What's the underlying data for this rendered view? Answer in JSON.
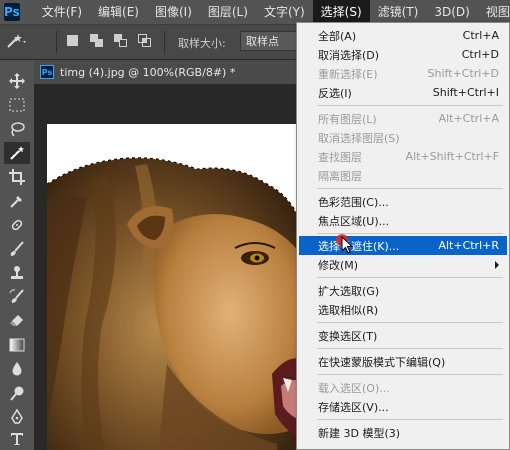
{
  "app": {
    "logo": "Ps"
  },
  "menubar": {
    "items": [
      "文件(F)",
      "编辑(E)",
      "图像(I)",
      "图层(L)",
      "文字(Y)",
      "选择(S)",
      "滤镜(T)",
      "3D(D)",
      "视图("
    ]
  },
  "options": {
    "sample_size_label": "取样大小:",
    "sample_size_value": "取样点"
  },
  "document": {
    "tab_title": "timg (4).jpg @ 100%(RGB/8#) *",
    "ps_icon": "Ps"
  },
  "select_menu": {
    "items": [
      {
        "label": "全部(A)",
        "shortcut": "Ctrl+A",
        "disabled": false
      },
      {
        "label": "取消选择(D)",
        "shortcut": "Ctrl+D",
        "disabled": false
      },
      {
        "label": "重新选择(E)",
        "shortcut": "Shift+Ctrl+D",
        "disabled": true
      },
      {
        "label": "反选(I)",
        "shortcut": "Shift+Ctrl+I",
        "disabled": false
      },
      {
        "label": "所有图层(L)",
        "shortcut": "Alt+Ctrl+A",
        "disabled": true
      },
      {
        "label": "取消选择图层(S)",
        "shortcut": "",
        "disabled": true
      },
      {
        "label": "查找图层",
        "shortcut": "Alt+Shift+Ctrl+F",
        "disabled": true
      },
      {
        "label": "隔离图层",
        "shortcut": "",
        "disabled": true
      },
      {
        "label": "色彩范围(C)...",
        "shortcut": "",
        "disabled": false
      },
      {
        "label": "焦点区域(U)...",
        "shortcut": "",
        "disabled": false
      },
      {
        "label": "选择并遮住(K)...",
        "shortcut": "Alt+Ctrl+R",
        "disabled": false,
        "highlighted": true
      },
      {
        "label": "修改(M)",
        "shortcut": "",
        "disabled": false,
        "submenu": true
      },
      {
        "label": "扩大选取(G)",
        "shortcut": "",
        "disabled": false
      },
      {
        "label": "选取相似(R)",
        "shortcut": "",
        "disabled": false
      },
      {
        "label": "变换选区(T)",
        "shortcut": "",
        "disabled": false
      },
      {
        "label": "在快速蒙版模式下编辑(Q)",
        "shortcut": "",
        "disabled": false
      },
      {
        "label": "载入选区(O)...",
        "shortcut": "",
        "disabled": true
      },
      {
        "label": "存储选区(V)...",
        "shortcut": "",
        "disabled": false
      },
      {
        "label": "新建 3D 模型(3)",
        "shortcut": "",
        "disabled": false
      }
    ]
  },
  "colors": {
    "highlight": "#0a64c8",
    "menu_bg": "#f0f0f0",
    "app_bg": "#535353"
  }
}
